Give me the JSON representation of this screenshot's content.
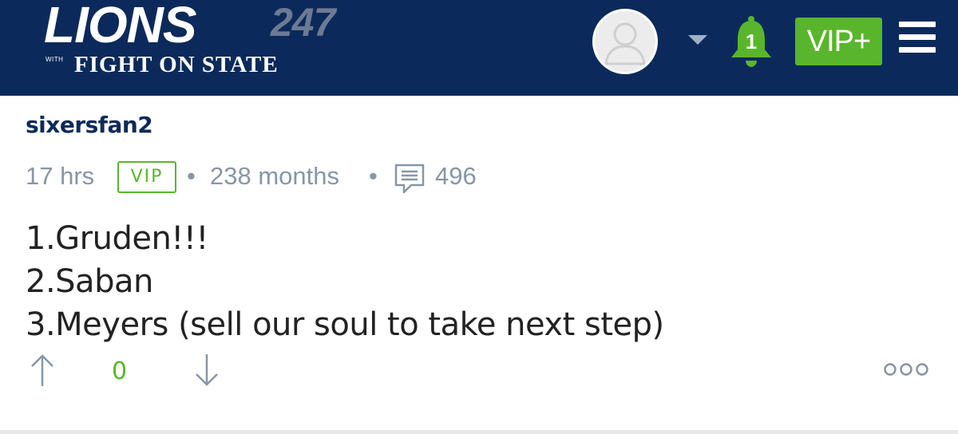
{
  "header": {
    "logo_main": "LIONS",
    "logo_number": "247",
    "logo_with": "WITH",
    "logo_sub": "FIGHT ON STATE",
    "notification_count": "1",
    "vip_button_label": "VIP+",
    "icons": [
      "user-avatar-icon",
      "chevron-down-icon",
      "bell-icon",
      "hamburger-menu-icon"
    ],
    "colors": {
      "bar": "#0b2a5b",
      "accent": "#59b52c"
    }
  },
  "post": {
    "username": "sixersfan2",
    "time": "17 hrs",
    "badge": "VIP",
    "separator": "•",
    "tenure": "238 months",
    "comment_count": "496",
    "lines": [
      "1.Gruden!!!",
      "2.Saban",
      "3.Meyers (sell our soul to take next step)"
    ],
    "vote_count": "0",
    "more_label": "ooo"
  }
}
